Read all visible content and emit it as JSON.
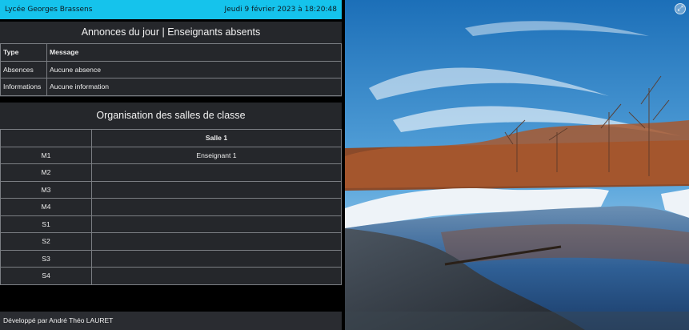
{
  "header": {
    "school": "Lycée Georges Brassens",
    "datetime": "Jeudi 9 février 2023 à 18:20:48"
  },
  "announcements": {
    "title": "Annonces du jour | Enseignants absents",
    "columns": [
      "Type",
      "Message"
    ],
    "rows": [
      {
        "type": "Absences",
        "message": "Aucune absence"
      },
      {
        "type": "Informations",
        "message": "Aucune information"
      }
    ]
  },
  "rooms": {
    "title": "Organisation des salles de classe",
    "columns": [
      "",
      "Salle 1"
    ],
    "rows": [
      {
        "slot": "M1",
        "salle1": "Enseignant 1"
      },
      {
        "slot": "M2",
        "salle1": ""
      },
      {
        "slot": "M3",
        "salle1": ""
      },
      {
        "slot": "M4",
        "salle1": ""
      },
      {
        "slot": "S1",
        "salle1": ""
      },
      {
        "slot": "S2",
        "salle1": ""
      },
      {
        "slot": "S3",
        "salle1": ""
      },
      {
        "slot": "S4",
        "salle1": ""
      }
    ]
  },
  "footer": {
    "credit": "Développé par André Théo LAURET"
  },
  "photo": {
    "expand_icon": "expand-icon"
  },
  "colors": {
    "accent": "#15c3ec",
    "panel": "#25272b",
    "background": "#000000"
  }
}
